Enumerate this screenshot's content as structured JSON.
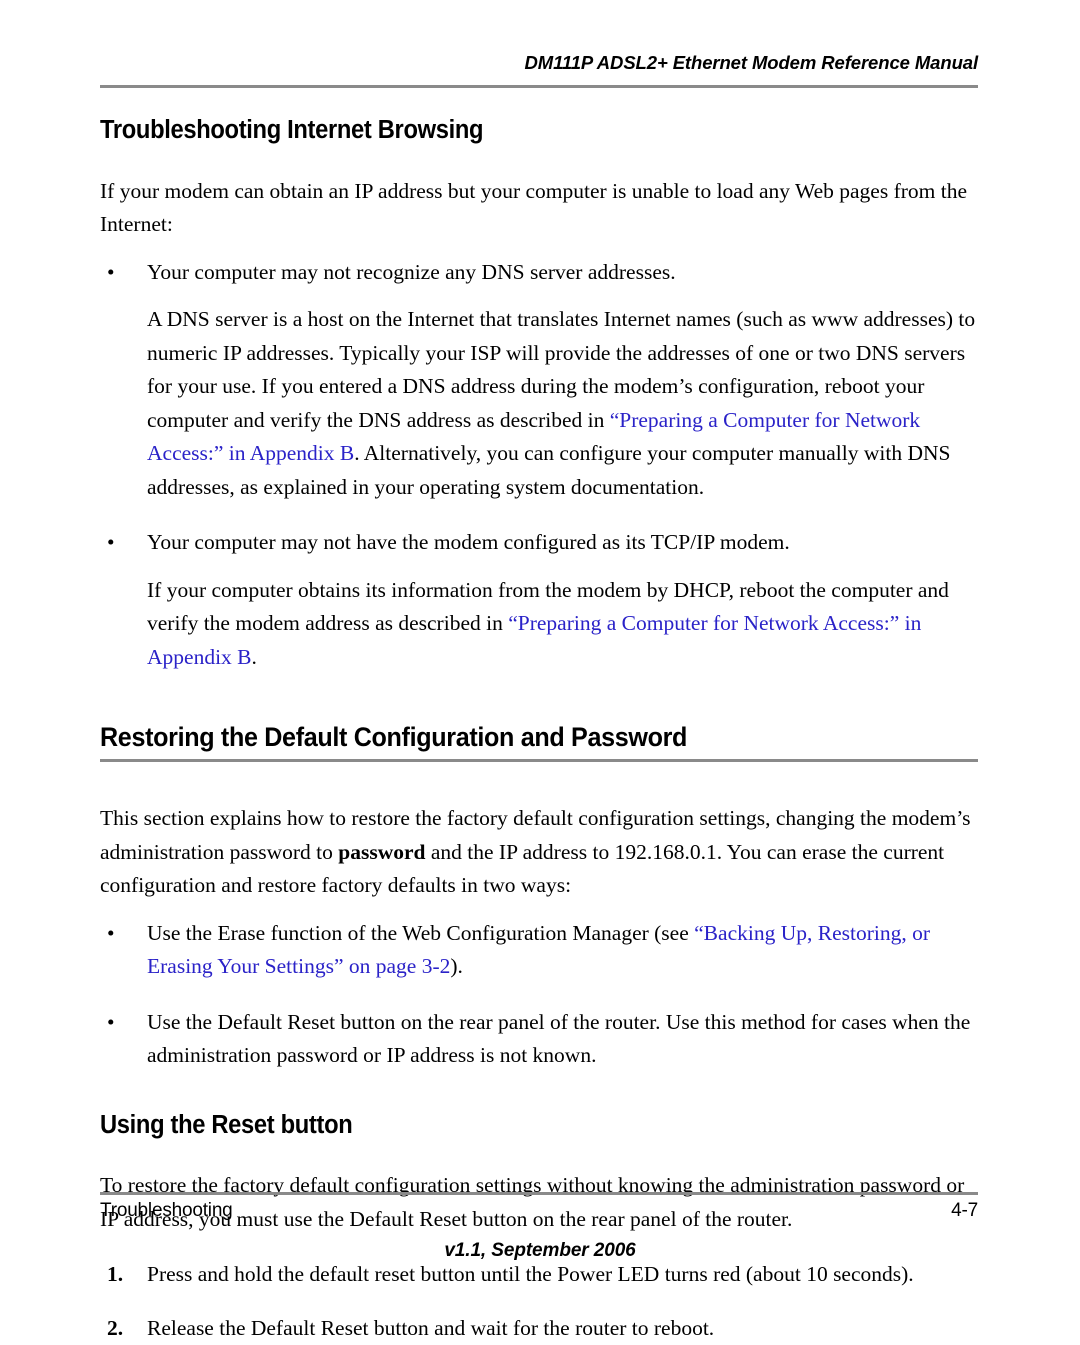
{
  "header": {
    "running_title": "DM111P ADSL2+ Ethernet Modem Reference Manual"
  },
  "sections": [
    {
      "id": "troubleshooting-internet-browsing",
      "title": "Troubleshooting Internet Browsing",
      "intro": "If your modem can obtain an IP address but your computer is unable to load any Web pages from the Internet:",
      "bullet_1": "Your computer may not recognize any DNS server addresses.",
      "para_1_a": "A DNS server is a host on the Internet that translates Internet names (such as www addresses) to numeric IP addresses. Typically your ISP will provide the addresses of one or two DNS servers for your use. If you entered a DNS address during the modem’s configuration, reboot your computer and verify the DNS address as described in ",
      "para_1_link": "“Preparing a Computer for Network Access:” in Appendix B",
      "para_1_b": ". Alternatively, you can configure your computer manually with DNS addresses, as explained in your operating system documentation.",
      "bullet_2": "Your computer may not have the modem configured as its TCP/IP modem.",
      "para_2_a": "If your computer obtains its information from the modem by DHCP, reboot the computer and verify the modem address as described in ",
      "para_2_link": "“Preparing a Computer for Network Access:” in Appendix B",
      "para_2_b": "."
    },
    {
      "id": "restoring-default-configuration",
      "title": "Restoring the Default Configuration and Password",
      "intro_a": "This section explains how to restore the factory default configuration settings, changing the modem’s administration password to ",
      "intro_bold": "password",
      "intro_b": " and the IP address to 192.168.0.1. You can erase the current configuration and restore factory defaults in two ways:",
      "bullet_1_a": "Use the Erase function of the Web Configuration Manager (see ",
      "bullet_1_link": "“Backing Up, Restoring, or Erasing Your Settings” on page 3-2",
      "bullet_1_b": ").",
      "bullet_2": "Use the Default Reset button on the rear panel of the router. Use this method for cases when the administration password or IP address is not known."
    },
    {
      "id": "using-the-reset-button",
      "title": "Using the Reset button",
      "intro": "To restore the factory default configuration settings without knowing the administration password or IP address, you must use the Default Reset button on the rear panel of the router.",
      "steps": [
        {
          "marker": "1.",
          "text": "Press and hold the default reset button until the Power LED turns red (about 10 seconds)."
        },
        {
          "marker": "2.",
          "text": "Release the Default Reset button and wait for the router to reboot."
        }
      ]
    }
  ],
  "bullet_glyph": "•",
  "footer": {
    "chapter_name": "Troubleshooting",
    "page_number": "4-7",
    "version": "v1.1, September 2006"
  },
  "colors": {
    "link": "#2a22c8",
    "rule": "#8a8a8a",
    "text": "#000000",
    "background": "#ffffff"
  }
}
